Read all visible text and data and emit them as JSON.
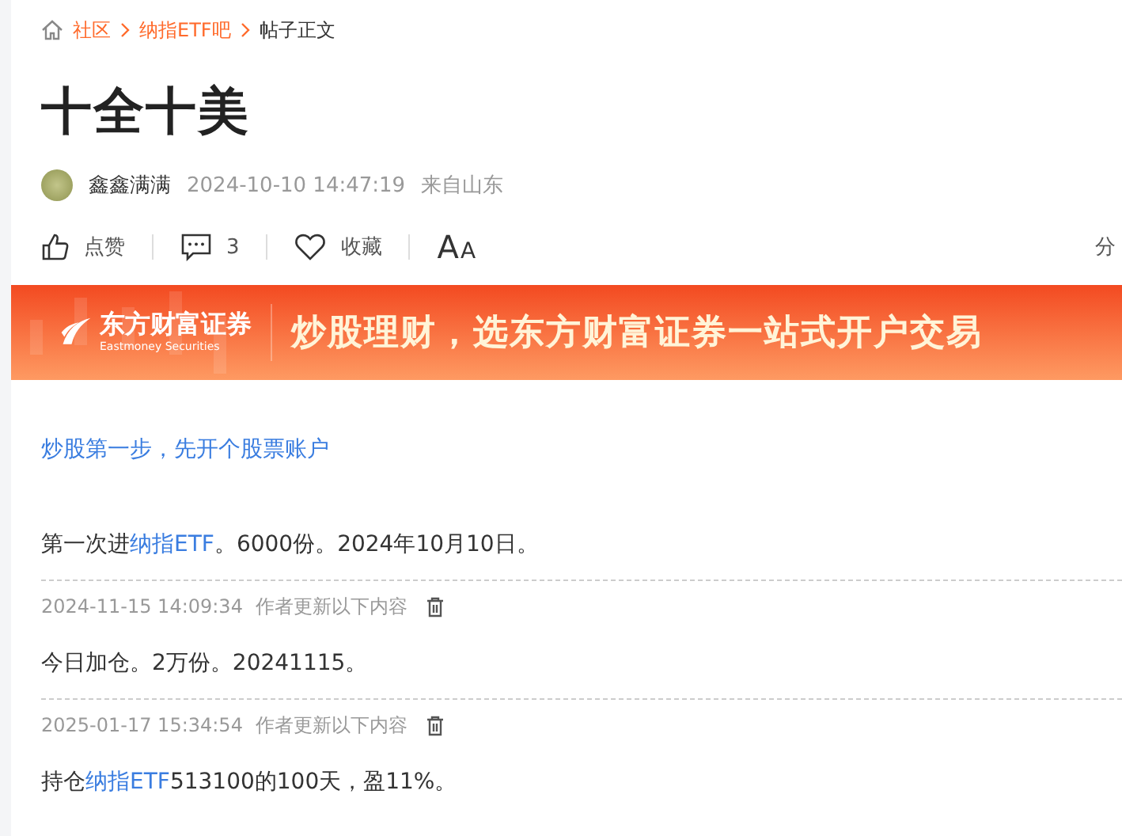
{
  "breadcrumb": [
    {
      "label": "社区",
      "kind": "link"
    },
    {
      "label": "纳指ETF吧",
      "kind": "link"
    },
    {
      "label": "帖子正文",
      "kind": "current"
    }
  ],
  "post": {
    "title": "十全十美",
    "author": "鑫鑫满满",
    "time": "2024-10-10 14:47:19",
    "location": "来自山东"
  },
  "actions": {
    "like": "点赞",
    "comments": "3",
    "favorite": "收藏",
    "font_big": "A",
    "font_small": "A",
    "share": "分"
  },
  "banner": {
    "brand": "东方财富证券",
    "brand_en": "Eastmoney Securities",
    "slogan": "炒股理财，选东方财富证券一站式开户交易"
  },
  "promo_link": "炒股第一步，先开个股票账户",
  "content": [
    {
      "segments": [
        {
          "kind": "text",
          "text": "第一次进"
        },
        {
          "kind": "link",
          "text": "纳指ETF"
        },
        {
          "kind": "text",
          "text": "。6000份。2024年10月10日。"
        }
      ]
    }
  ],
  "updates": [
    {
      "time": "2024-11-15 14:09:34",
      "note": "作者更新以下内容",
      "segments": [
        {
          "kind": "text",
          "text": "今日加仓。2万份。20241115。"
        }
      ]
    },
    {
      "time": "2025-01-17 15:34:54",
      "note": "作者更新以下内容",
      "segments": [
        {
          "kind": "text",
          "text": "持仓"
        },
        {
          "kind": "link",
          "text": "纳指ETF"
        },
        {
          "kind": "text",
          "text": "513100的100天，盈11%。"
        }
      ]
    }
  ]
}
